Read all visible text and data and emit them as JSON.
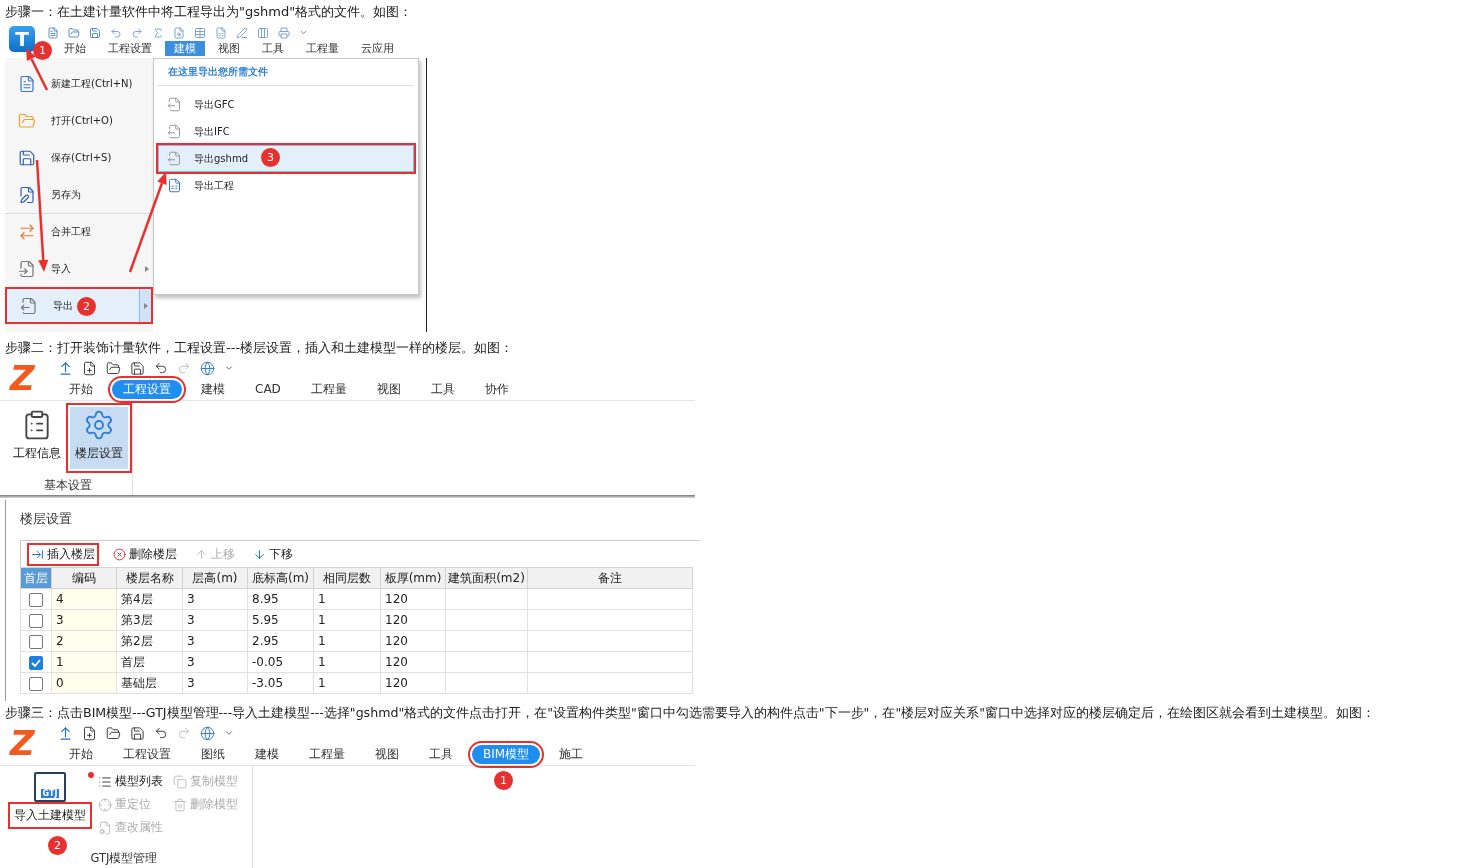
{
  "step1": {
    "caption": "步骤一：在土建计量软件中将工程导出为\"gshmd\"格式的文件。如图：",
    "app_logo": "T",
    "app_callout": "1",
    "tabs": [
      {
        "label": "开始",
        "selected": false
      },
      {
        "label": "工程设置",
        "selected": false
      },
      {
        "label": "建模",
        "selected": true
      },
      {
        "label": "视图",
        "selected": false
      },
      {
        "label": "工具",
        "selected": false
      },
      {
        "label": "工程量",
        "selected": false
      },
      {
        "label": "云应用",
        "selected": false
      }
    ],
    "menu": [
      {
        "label": "新建工程(Ctrl+N)",
        "kind": "new",
        "separator_above": false,
        "has_submenu": false,
        "selected": false,
        "outlined": false
      },
      {
        "label": "打开(Ctrl+O)",
        "kind": "open",
        "separator_above": false,
        "has_submenu": false,
        "selected": false,
        "outlined": false
      },
      {
        "label": "保存(Ctrl+S)",
        "kind": "save",
        "separator_above": false,
        "has_submenu": false,
        "selected": false,
        "outlined": false
      },
      {
        "label": "另存为",
        "kind": "saveas",
        "separator_above": false,
        "has_submenu": false,
        "selected": false,
        "outlined": false
      },
      {
        "label": "合并工程",
        "kind": "merge",
        "separator_above": true,
        "has_submenu": false,
        "selected": false,
        "outlined": false
      },
      {
        "label": "导入",
        "kind": "import",
        "separator_above": false,
        "has_submenu": true,
        "selected": false,
        "outlined": false
      },
      {
        "label": "导出",
        "kind": "export",
        "separator_above": false,
        "has_submenu": true,
        "selected": true,
        "outlined": true,
        "callout": "2"
      }
    ],
    "submenu": {
      "header": "在这里导出您所需文件",
      "items": [
        {
          "label": "导出GFC",
          "kind": "file",
          "selected": false,
          "outlined": false
        },
        {
          "label": "导出IFC",
          "kind": "file",
          "selected": false,
          "outlined": false
        },
        {
          "label": "导出gshmd",
          "kind": "file",
          "selected": true,
          "outlined": true,
          "callout": "3"
        },
        {
          "label": "导出工程",
          "kind": "project",
          "selected": false,
          "outlined": false
        }
      ]
    }
  },
  "step2": {
    "caption": "步骤二：打开装饰计量软件，工程设置---楼层设置，插入和土建模型一样的楼层。如图：",
    "logo": "Z",
    "tabs": [
      {
        "label": "开始",
        "selected": false,
        "outlined": false
      },
      {
        "label": "工程设置",
        "selected": true,
        "outlined": true
      },
      {
        "label": "建模",
        "selected": false,
        "outlined": false
      },
      {
        "label": "CAD",
        "selected": false,
        "outlined": false
      },
      {
        "label": "工程量",
        "selected": false,
        "outlined": false
      },
      {
        "label": "视图",
        "selected": false,
        "outlined": false
      },
      {
        "label": "工具",
        "selected": false,
        "outlined": false
      },
      {
        "label": "协作",
        "selected": false,
        "outlined": false
      }
    ],
    "ribbon": {
      "buttons": [
        {
          "label": "工程信息",
          "kind": "info",
          "selected": false,
          "outlined": false
        },
        {
          "label": "楼层设置",
          "kind": "floors",
          "selected": true,
          "outlined": true
        }
      ],
      "group_label": "基本设置"
    },
    "floor_panel": {
      "title": "楼层设置",
      "tools": [
        {
          "label": "插入楼层",
          "kind": "insert",
          "disabled": false,
          "outlined": true
        },
        {
          "label": "删除楼层",
          "kind": "delete",
          "disabled": false,
          "outlined": false
        },
        {
          "label": "上移",
          "kind": "up",
          "disabled": true,
          "outlined": false
        },
        {
          "label": "下移",
          "kind": "down",
          "disabled": false,
          "outlined": false
        }
      ],
      "columns": [
        "首层",
        "编码",
        "楼层名称",
        "层高(m)",
        "底标高(m)",
        "相同层数",
        "板厚(mm)",
        "建筑面积(m2)",
        "备注"
      ],
      "rows": [
        {
          "checked": false,
          "cells": [
            "",
            "4",
            "第4层",
            "3",
            "8.95",
            "1",
            "120"
          ]
        },
        {
          "checked": false,
          "cells": [
            "",
            "3",
            "第3层",
            "3",
            "5.95",
            "1",
            "120"
          ]
        },
        {
          "checked": false,
          "cells": [
            "",
            "2",
            "第2层",
            "3",
            "2.95",
            "1",
            "120"
          ]
        },
        {
          "checked": true,
          "cells": [
            "",
            "1",
            "首层",
            "3",
            "-0.05",
            "1",
            "120"
          ]
        },
        {
          "checked": false,
          "cells": [
            "",
            "0",
            "基础层",
            "3",
            "-3.05",
            "1",
            "120"
          ]
        }
      ]
    }
  },
  "step3": {
    "caption": "步骤三：点击BIM模型---GTJ模型管理---导入土建模型---选择\"gshmd\"格式的文件点击打开，在\"设置构件类型\"窗口中勾选需要导入的构件点击\"下一步\"，在\"楼层对应关系\"窗口中选择对应的楼层确定后，在绘图区就会看到土建模型。如图：",
    "logo": "Z",
    "tabs": [
      {
        "label": "开始",
        "selected": false,
        "outlined": false
      },
      {
        "label": "工程设置",
        "selected": false,
        "outlined": false
      },
      {
        "label": "图纸",
        "selected": false,
        "outlined": false
      },
      {
        "label": "建模",
        "selected": false,
        "outlined": false
      },
      {
        "label": "工程量",
        "selected": false,
        "outlined": false
      },
      {
        "label": "视图",
        "selected": false,
        "outlined": false
      },
      {
        "label": "工具",
        "selected": false,
        "outlined": false
      },
      {
        "label": "BIM模型",
        "selected": true,
        "outlined": true,
        "callout": "1"
      },
      {
        "label": "施工",
        "selected": false,
        "outlined": false
      }
    ],
    "ribbon": {
      "main_button": {
        "label": "导入土建模型",
        "badge": "GTJ",
        "outlined": true,
        "callout": "2"
      },
      "small_buttons": [
        {
          "label": "模型列表",
          "kind": "list",
          "disabled": false,
          "notified": true
        },
        {
          "label": "重定位",
          "kind": "relocate",
          "disabled": true,
          "notified": false
        },
        {
          "label": "查改属性",
          "kind": "props",
          "disabled": true,
          "notified": false
        },
        {
          "label": "复制模型",
          "kind": "copy",
          "disabled": true,
          "notified": false
        },
        {
          "label": "删除模型",
          "kind": "trash",
          "disabled": true,
          "notified": false
        }
      ],
      "group_label": "GTJ模型管理"
    }
  }
}
